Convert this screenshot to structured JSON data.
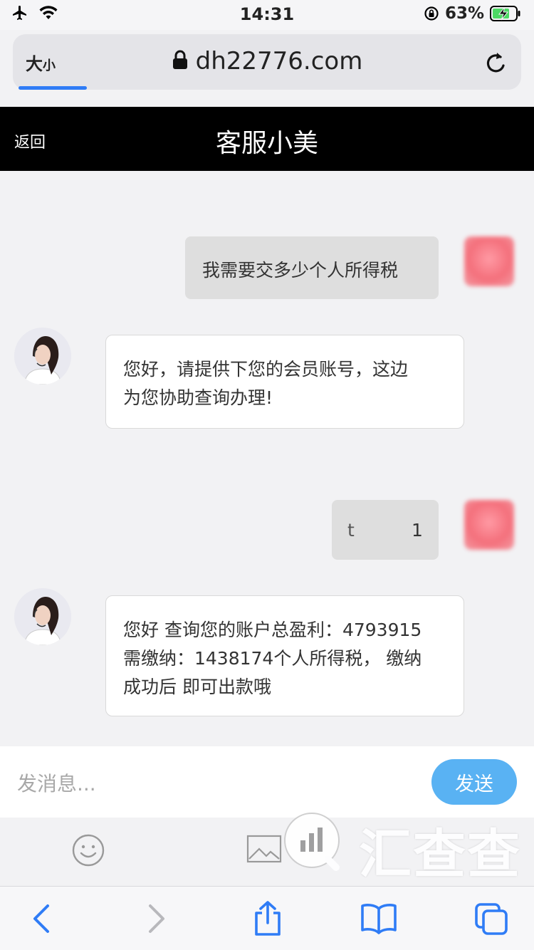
{
  "status_bar": {
    "time": "14:31",
    "battery": "63%"
  },
  "browser": {
    "text_size_label": "大",
    "text_size_small": "小",
    "url": "dh22776.com"
  },
  "header": {
    "back": "返回",
    "title": "客服小美"
  },
  "messages": {
    "m1": "我需要交多少个人所得税",
    "m2_line1": "您好，请提供下您的会员账号，这边",
    "m2_line2": "为您协助查询办理!",
    "m3_a": "t",
    "m3_b": "1",
    "m4_line1": "您好 查询您的账户总盈利：4793915",
    "m4_line2": "需缴纳：1438174个人所得税， 缴纳",
    "m4_line3": "成功后 即可出款哦"
  },
  "composer": {
    "placeholder": "发消息...",
    "send": "发送"
  },
  "watermark": {
    "text": "汇查查"
  },
  "colors": {
    "accent": "#2f7cf6",
    "send_button": "#59b2f3",
    "header_bg": "#000000"
  }
}
